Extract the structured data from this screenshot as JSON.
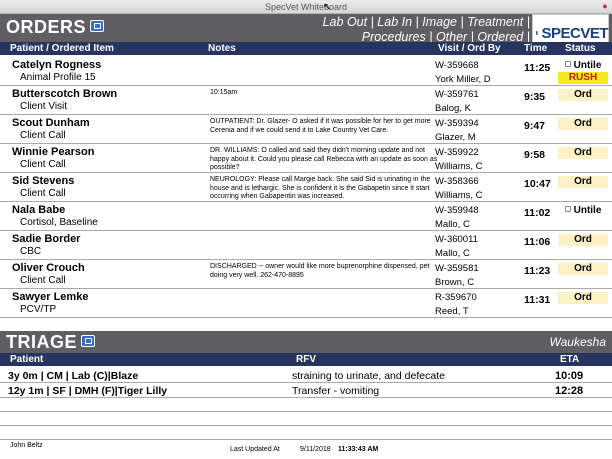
{
  "window": {
    "title": "SpecVet Whiteboard"
  },
  "orders": {
    "title": "ORDERS",
    "nav": [
      "Lab Out",
      "Lab In",
      "Image",
      "Treatment",
      "Procedures",
      "Other",
      "Ordered"
    ],
    "columns": {
      "patient": "Patient / Ordered Item",
      "notes": "Notes",
      "visit": "Visit / Ord By",
      "time": "Time",
      "status": "Status"
    },
    "rows": [
      {
        "patient": "Catelyn Rogness",
        "item": "Animal Profile 15",
        "notes": "",
        "visit": "W-359668",
        "ordby": "York Miller, D",
        "time": "11:25",
        "status": "Untile",
        "status_icon": true,
        "rush": "RUSH"
      },
      {
        "patient": "Butterscotch Brown",
        "item": "Client Visit",
        "notes": "10:15am",
        "visit": "W-359761",
        "ordby": "Balog, K",
        "time": "9:35",
        "status": "Ord",
        "status_icon": false,
        "rush": ""
      },
      {
        "patient": "Scout Dunham",
        "item": "Client Call",
        "notes": "OUTPATIENT: Dr. Glazer- O asked if it was possible for her to get more Cerenia and if we could send it to Lake Country Vet Care.",
        "visit": "W-359394",
        "ordby": "Glazer, M",
        "time": "9:47",
        "status": "Ord",
        "status_icon": false,
        "rush": ""
      },
      {
        "patient": "Winnie Pearson",
        "item": "Client Call",
        "notes": "DR. WILLIAMS: O called and said they didn't morning update and not happy about it. Could you please call Rebecca with an update as soon as possible?",
        "visit": "W-359922",
        "ordby": "Williams, C",
        "time": "9:58",
        "status": "Ord",
        "status_icon": false,
        "rush": ""
      },
      {
        "patient": "Sid Stevens",
        "item": "Client Call",
        "notes": "NEUROLOGY: Please call Margie back. She said Sid is urinating in the house and is lethargic. She is confident it is the Gabapetin since it start occurring when Gabapentin was increased.",
        "visit": "W-358366",
        "ordby": "Williams, C",
        "time": "10:47",
        "status": "Ord",
        "status_icon": false,
        "rush": ""
      },
      {
        "patient": "Nala Babe",
        "item": "Cortisol, Baseline",
        "notes": "",
        "visit": "W-359948",
        "ordby": "Mallo, C",
        "time": "11:02",
        "status": "Untile",
        "status_icon": true,
        "rush": ""
      },
      {
        "patient": "Sadie Border",
        "item": "CBC",
        "notes": "",
        "visit": "W-360011",
        "ordby": "Mallo, C",
        "time": "11:06",
        "status": "Ord",
        "status_icon": false,
        "rush": ""
      },
      {
        "patient": "Oliver Crouch",
        "item": "Client Call",
        "notes": "DISCHARGED -- owner would like more buprenorphine dispensed, pet doing very well. 262-470-8895",
        "visit": "W-359581",
        "ordby": "Brown, C",
        "time": "11:23",
        "status": "Ord",
        "status_icon": false,
        "rush": ""
      },
      {
        "patient": "Sawyer Lemke",
        "item": "PCV/TP",
        "notes": "",
        "visit": "R-359670",
        "ordby": "Reed, T",
        "time": "11:31",
        "status": "Ord",
        "status_icon": false,
        "rush": ""
      }
    ]
  },
  "logo": {
    "text": "SPECVET",
    "color": "#1c3f7a"
  },
  "triage": {
    "title": "TRIAGE",
    "location": "Waukesha",
    "columns": {
      "patient": "Patient",
      "rfv": "RFV",
      "eta": "ETA"
    },
    "rows": [
      {
        "patient": "3y 0m | CM | Lab (C)|Blaze",
        "rfv": "straining to urinate, and defecate",
        "eta": "10:09"
      },
      {
        "patient": "12y 1m | SF | DMH (F)|Tiger Lilly",
        "rfv": "Transfer - vomiting",
        "eta": "12:28"
      }
    ]
  },
  "footer": {
    "user": "John Beltz",
    "updated_label": "Last Updated At",
    "date": "9/11/2018",
    "time": "11:33:43 AM"
  },
  "colors": {
    "header_gray": "#5f5f63",
    "column_navy": "#27345f",
    "status_bg": "#fbf1c5",
    "rush_bg": "#f6ea1f",
    "rush_text": "#c91a1a"
  }
}
